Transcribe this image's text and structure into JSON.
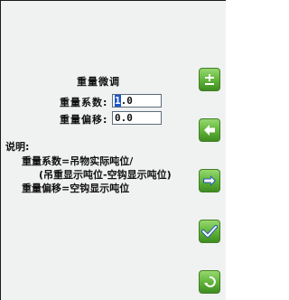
{
  "panel": {
    "title": "重量微调",
    "fields": [
      {
        "label": "重量系数:",
        "value": "1.0",
        "cursor_char": "1",
        "rest": ".0"
      },
      {
        "label": "重量偏移:",
        "value": "0.0"
      }
    ]
  },
  "notes": {
    "heading": "说明:",
    "lines": [
      "重量系数=吊物实际吨位/",
      "(吊重显示吨位-空钩显示吨位)",
      "重量偏移=空钩显示吨位"
    ]
  },
  "side_buttons": [
    {
      "name": "plus-minus-icon"
    },
    {
      "name": "arrow-left-icon"
    },
    {
      "name": "arrow-right-icon"
    },
    {
      "name": "check-icon"
    },
    {
      "name": "return-icon"
    }
  ],
  "colors": {
    "background": "#f0f1f1",
    "button_green": "#5fb237",
    "cursor_blue": "#1d57c8"
  }
}
